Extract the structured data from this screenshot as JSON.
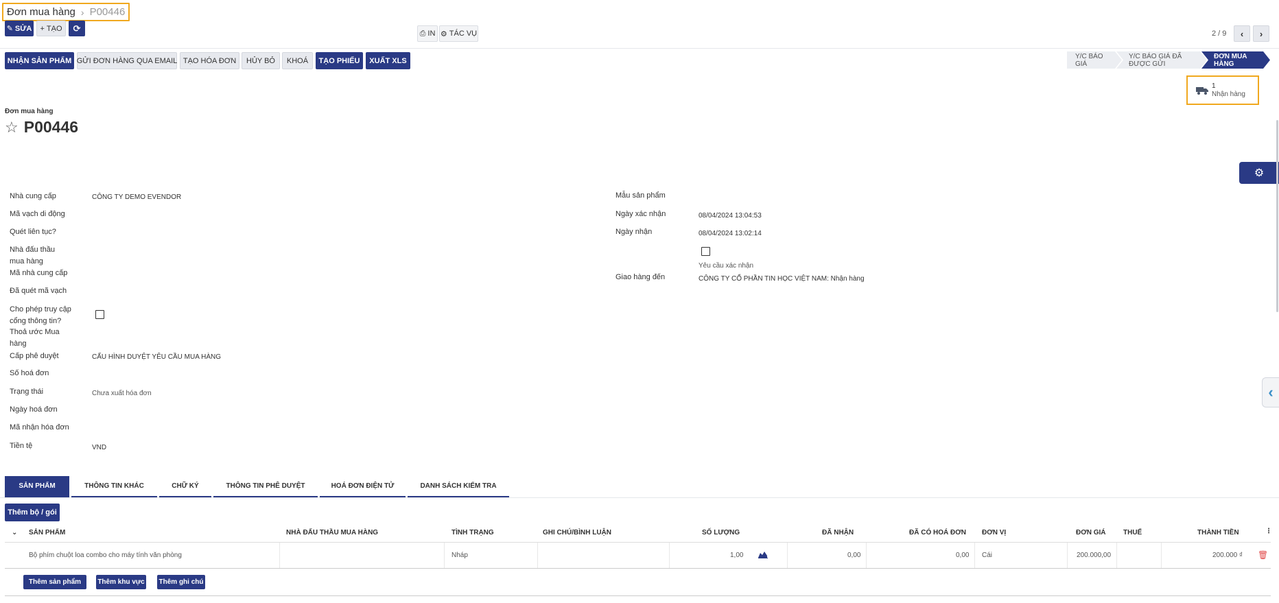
{
  "breadcrumb": {
    "parent": "Đơn mua hàng",
    "current": "P00446"
  },
  "toolbar": {
    "edit": "SỬA",
    "create": "TẠO",
    "print": "IN",
    "actions": "TÁC VỤ",
    "pager": "2 / 9"
  },
  "action_buttons": {
    "receive": "NHẬN SẢN PHẨM",
    "send_email": "GỬI ĐƠN HÀNG QUA EMAIL",
    "create_invoice": "TẠO HÓA ĐƠN",
    "cancel": "HỦY BỎ",
    "lock": "KHOÁ",
    "create_voucher": "TẠO PHIẾU",
    "export_xls": "XUẤT XLS"
  },
  "status_stages": [
    "Y/C BÁO GIÁ",
    "Y/C BÁO GIÁ ĐÃ ĐƯỢC GỬI",
    "ĐƠN MUA HÀNG"
  ],
  "smart_button": {
    "count": "1",
    "label": "Nhận hàng"
  },
  "form": {
    "subtitle": "Đơn mua hàng",
    "name": "P00446",
    "left": {
      "vendor_label": "Nhà cung cấp",
      "vendor_value": "CÔNG TY DEMO EVENDOR",
      "mobile_barcode_label": "Mã vạch di động",
      "continuous_scan_label": "Quét liên tục?",
      "bidder_label_1": "Nhà đấu thầu",
      "bidder_label_2": "mua hàng",
      "vendor_code_label": "Mã nhà cung cấp",
      "scanned_barcode_label": "Đã quét mã vạch",
      "portal_label_1": "Cho phép truy cập",
      "portal_label_2": "cổng thông tin?",
      "agreement_label_1": "Thoả ước Mua",
      "agreement_label_2": "hàng",
      "approval_label": "Cấp phê duyệt",
      "approval_value": "CẤU HÌNH DUYỆT YÊU CẦU MUA HÀNG",
      "invoice_no_label": "Số hoá đơn",
      "status_label": "Trạng thái",
      "status_value": "Chưa xuất hóa đơn",
      "invoice_date_label": "Ngày hoá đơn",
      "invoice_code_label": "Mã nhận hóa đơn",
      "currency_label": "Tiền tệ",
      "currency_value": "VND"
    },
    "right": {
      "sample_label": "Mẫu sản phẩm",
      "confirm_date_label": "Ngày xác nhận",
      "confirm_date_value": "08/04/2024 13:04:53",
      "receipt_date_label": "Ngày nhận",
      "receipt_date_value": "08/04/2024 13:02:14",
      "ask_confirm_label": "Yêu cầu xác nhận",
      "deliver_to_label": "Giao hàng đến",
      "deliver_to_value": "CÔNG TY CỔ PHẦN TIN HỌC VIỆT NAM: Nhận hàng"
    }
  },
  "tabs": [
    "SẢN PHẨM",
    "THÔNG TIN KHÁC",
    "CHỮ KÝ",
    "THÔNG TIN PHÊ DUYỆT",
    "HOÁ ĐƠN ĐIỆN TỬ",
    "DANH SÁCH KIỂM TRA"
  ],
  "lines": {
    "add_pack": "Thêm bộ / gói",
    "headers": [
      "SẢN PHẨM",
      "NHÀ ĐẤU THẦU MUA HÀNG",
      "TÌNH TRẠNG",
      "GHI CHÚ/BÌNH LUẬN",
      "SỐ LƯỢNG",
      "ĐÃ NHẬN",
      "ĐÃ CÓ HOÁ ĐƠN",
      "ĐƠN VỊ",
      "ĐƠN GIÁ",
      "THUẾ",
      "THÀNH TIỀN"
    ],
    "rows": [
      {
        "product": "Bộ phím chuột loa combo cho máy tính văn phòng",
        "bidder": "",
        "state": "Nháp",
        "note": "",
        "qty": "1,00",
        "received": "0,00",
        "invoiced": "0,00",
        "uom": "Cái",
        "price": "200.000,00",
        "tax": "",
        "subtotal": "200.000 ₫"
      }
    ],
    "add_product": "Thêm sản phẩm",
    "add_section": "Thêm khu vực",
    "add_note": "Thêm ghi chú"
  },
  "colors": {
    "primary": "#2a3a85",
    "highlight": "#f0a81e",
    "delete": "#e24c4c"
  },
  "icons": [
    "pencil-icon",
    "plus-icon",
    "refresh-icon",
    "print-icon",
    "gear-icon",
    "chevron-left-icon",
    "chevron-right-icon",
    "truck-icon",
    "star-icon",
    "chart-icon",
    "trash-icon",
    "kebab-icon",
    "chevron-down-icon"
  ]
}
